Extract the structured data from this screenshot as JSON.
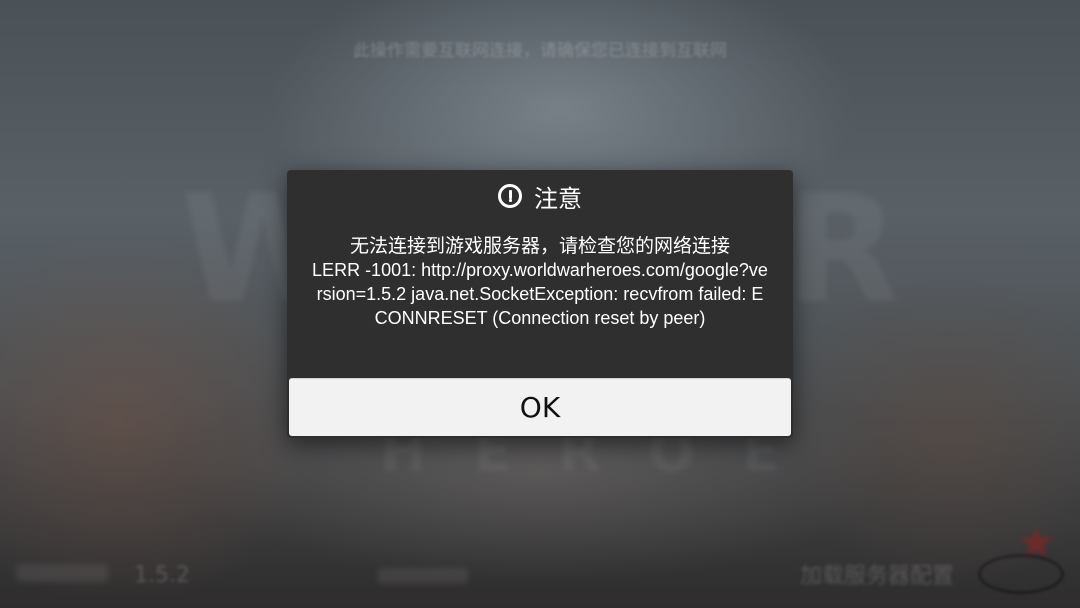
{
  "background": {
    "banner_text": "此操作需要互联网连接，请确保您已连接到互联网",
    "version": "1.5.2",
    "status_text": "加载服务器配置"
  },
  "dialog": {
    "icon": "alert-circle-icon",
    "title": "注意",
    "message_line": "无法连接到游戏服务器，请检查您的网络连接",
    "message_detail": "LERR -1001: http://proxy.worldwarheroes.com/google?version=1.5.2 java.net.SocketException: recvfrom failed: ECONNRESET (Connection reset by peer)",
    "ok_label": "OK"
  }
}
